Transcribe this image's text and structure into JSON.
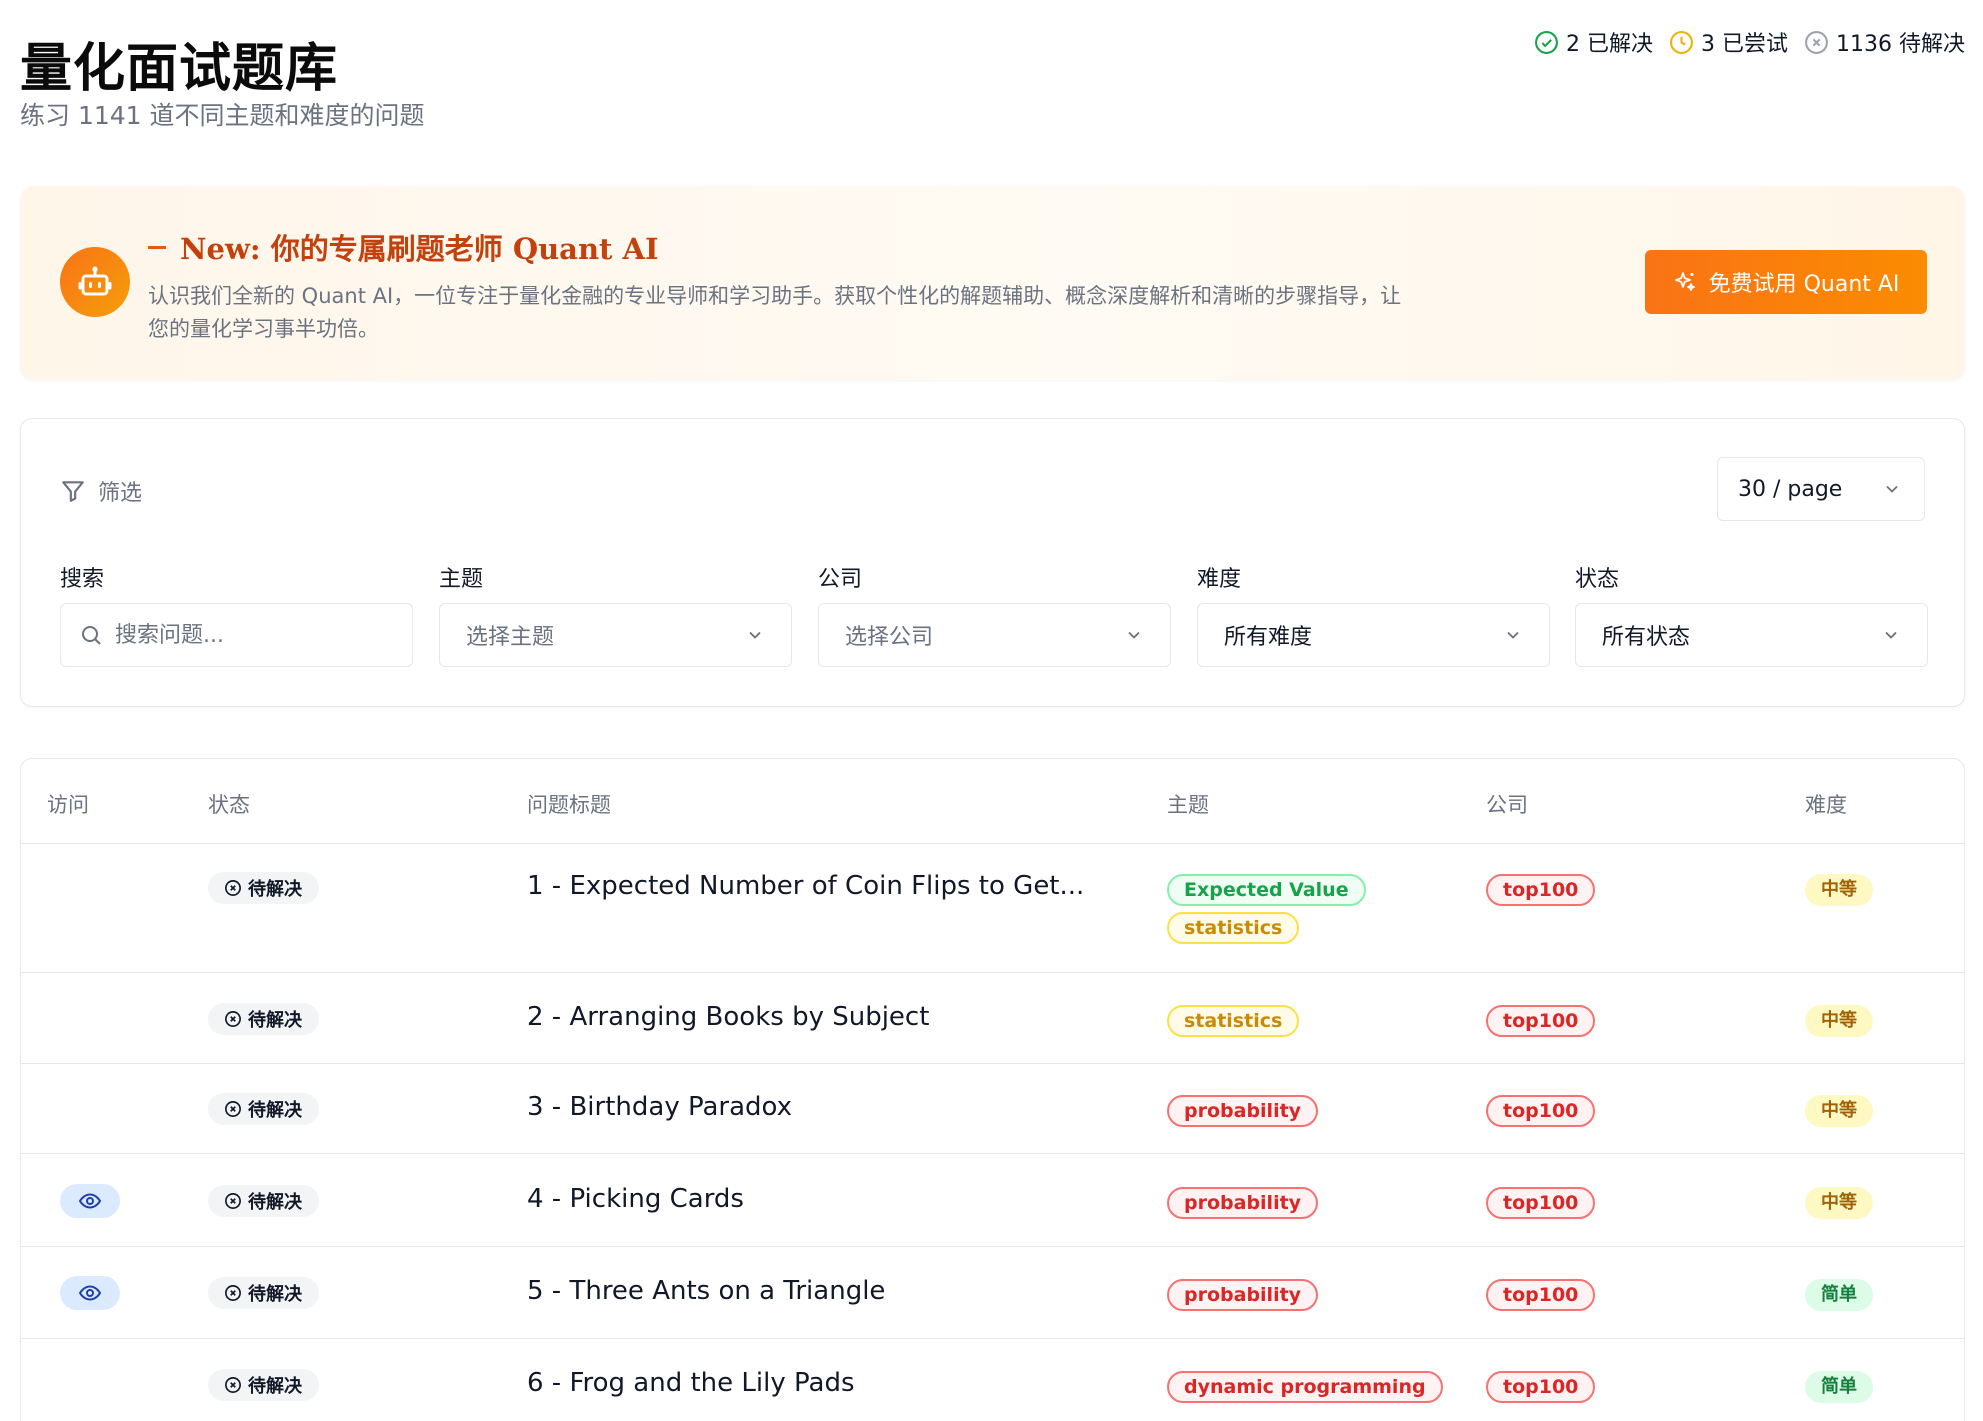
{
  "header": {
    "title": "量化面试题库",
    "subtitle": "练习 1141 道不同主题和难度的问题",
    "stats": {
      "solved": "2 已解决",
      "attempted": "3 已尝试",
      "unsolved": "1136 待解决"
    }
  },
  "banner": {
    "heading": "New: 你的专属刷题老师 Quant AI",
    "text": "认识我们全新的 Quant AI，一位专注于量化金融的专业导师和学习助手。获取个性化的解题辅助、概念深度解析和清晰的步骤指导，让您的量化学习事半功倍。",
    "button_label": "免费试用 Quant AI"
  },
  "filters": {
    "label": "筛选",
    "page_size": "30 / page",
    "search": {
      "label": "搜索",
      "placeholder": "搜索问题..."
    },
    "topic": {
      "label": "主题",
      "placeholder": "选择主题"
    },
    "company": {
      "label": "公司",
      "placeholder": "选择公司"
    },
    "difficulty": {
      "label": "难度",
      "value": "所有难度"
    },
    "status": {
      "label": "状态",
      "value": "所有状态"
    }
  },
  "table": {
    "columns": [
      "访问",
      "状态",
      "问题标题",
      "主题",
      "公司",
      "难度"
    ],
    "rows": [
      {
        "visited": false,
        "status": "待解决",
        "title": "1 - Expected Number of Coin Flips to Get...",
        "topics": [
          {
            "name": "Expected Value",
            "color": "green"
          },
          {
            "name": "statistics",
            "color": "yellow"
          }
        ],
        "company": "top100",
        "difficulty": "中等",
        "difficulty_level": "medium"
      },
      {
        "visited": false,
        "status": "待解决",
        "title": "2 - Arranging Books by Subject",
        "topics": [
          {
            "name": "statistics",
            "color": "yellow"
          }
        ],
        "company": "top100",
        "difficulty": "中等",
        "difficulty_level": "medium"
      },
      {
        "visited": false,
        "status": "待解决",
        "title": "3 - Birthday Paradox",
        "topics": [
          {
            "name": "probability",
            "color": "red"
          }
        ],
        "company": "top100",
        "difficulty": "中等",
        "difficulty_level": "medium"
      },
      {
        "visited": true,
        "status": "待解决",
        "title": "4 - Picking Cards",
        "topics": [
          {
            "name": "probability",
            "color": "red"
          }
        ],
        "company": "top100",
        "difficulty": "中等",
        "difficulty_level": "medium"
      },
      {
        "visited": true,
        "status": "待解决",
        "title": "5 - Three Ants on a Triangle",
        "topics": [
          {
            "name": "probability",
            "color": "red"
          }
        ],
        "company": "top100",
        "difficulty": "简单",
        "difficulty_level": "easy"
      },
      {
        "visited": false,
        "status": "待解决",
        "title": "6 - Frog and the Lily Pads",
        "topics": [
          {
            "name": "dynamic programming",
            "color": "red"
          }
        ],
        "company": "top100",
        "difficulty": "简单",
        "difficulty_level": "easy"
      }
    ]
  },
  "colors": {
    "accent_orange": "#f97316",
    "solved_green": "#16a34a",
    "attempted_yellow": "#eab308",
    "unsolved_gray": "#9ca3af"
  }
}
